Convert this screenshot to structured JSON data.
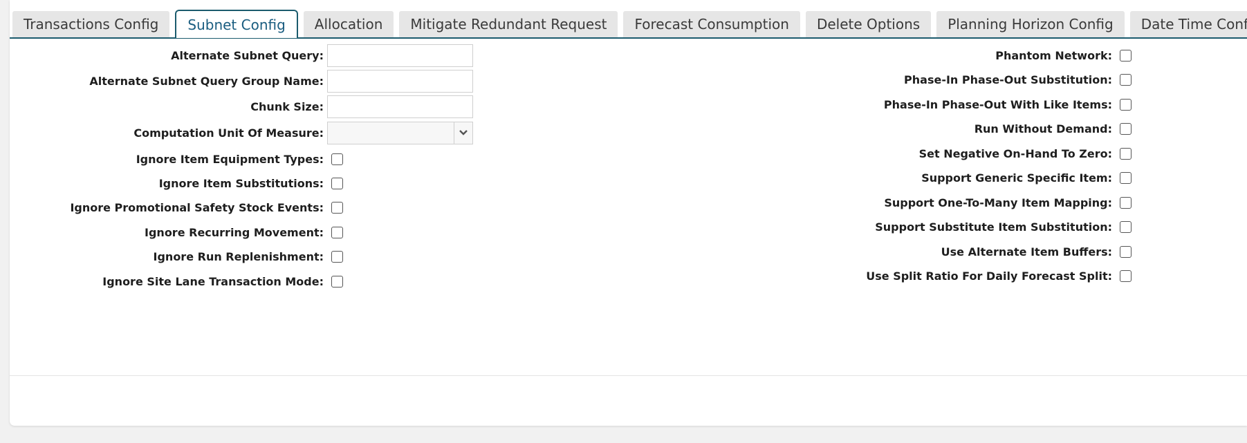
{
  "tabs": [
    {
      "label": "Transactions Config"
    },
    {
      "label": "Subnet Config",
      "active": true
    },
    {
      "label": "Allocation"
    },
    {
      "label": "Mitigate Redundant Request"
    },
    {
      "label": "Forecast Consumption"
    },
    {
      "label": "Delete Options"
    },
    {
      "label": "Planning Horizon Config"
    },
    {
      "label": "Date Time Config"
    }
  ],
  "left_fields": {
    "alternate_subnet_query": {
      "label": "Alternate Subnet Query:",
      "value": ""
    },
    "alternate_subnet_query_group_name": {
      "label": "Alternate Subnet Query Group Name:",
      "value": ""
    },
    "chunk_size": {
      "label": "Chunk Size:",
      "value": ""
    },
    "computation_unit_of_measure": {
      "label": "Computation Unit Of Measure:",
      "value": ""
    },
    "ignore_item_equipment_types": {
      "label": "Ignore Item Equipment Types:",
      "checked": false
    },
    "ignore_item_substitutions": {
      "label": "Ignore Item Substitutions:",
      "checked": false
    },
    "ignore_promotional_safety_stock_events": {
      "label": "Ignore Promotional Safety Stock Events:",
      "checked": false
    },
    "ignore_recurring_movement": {
      "label": "Ignore Recurring Movement:",
      "checked": false
    },
    "ignore_run_replenishment": {
      "label": "Ignore Run Replenishment:",
      "checked": false
    },
    "ignore_site_lane_transaction_mode": {
      "label": "Ignore Site Lane Transaction Mode:",
      "checked": false
    }
  },
  "right_fields": {
    "phantom_network": {
      "label": "Phantom Network:",
      "checked": false
    },
    "phase_in_phase_out_substitution": {
      "label": "Phase-In Phase-Out Substitution:",
      "checked": false
    },
    "phase_in_phase_out_with_like_items": {
      "label": "Phase-In Phase-Out With Like Items:",
      "checked": false
    },
    "run_without_demand": {
      "label": "Run Without Demand:",
      "checked": false
    },
    "set_negative_on_hand_to_zero": {
      "label": "Set Negative On-Hand To Zero:",
      "checked": false
    },
    "support_generic_specific_item": {
      "label": "Support Generic Specific Item:",
      "checked": false
    },
    "support_one_to_many_item_mapping": {
      "label": "Support One-To-Many Item Mapping:",
      "checked": false
    },
    "support_substitute_item_substitution": {
      "label": "Support Substitute Item Substitution:",
      "checked": false
    },
    "use_alternate_item_buffers": {
      "label": "Use Alternate Item Buffers:",
      "checked": false
    },
    "use_split_ratio_for_daily_forecast_split": {
      "label": "Use Split Ratio For Daily Forecast Split:",
      "checked": false
    }
  },
  "icons": {
    "select_chevron": "chevron-down-icon"
  },
  "colors": {
    "accent": "#1b5b6d",
    "active_tab_text": "#1a5d80",
    "tab_bg": "#e6e6e6",
    "page_bg": "#f1f1f1"
  }
}
